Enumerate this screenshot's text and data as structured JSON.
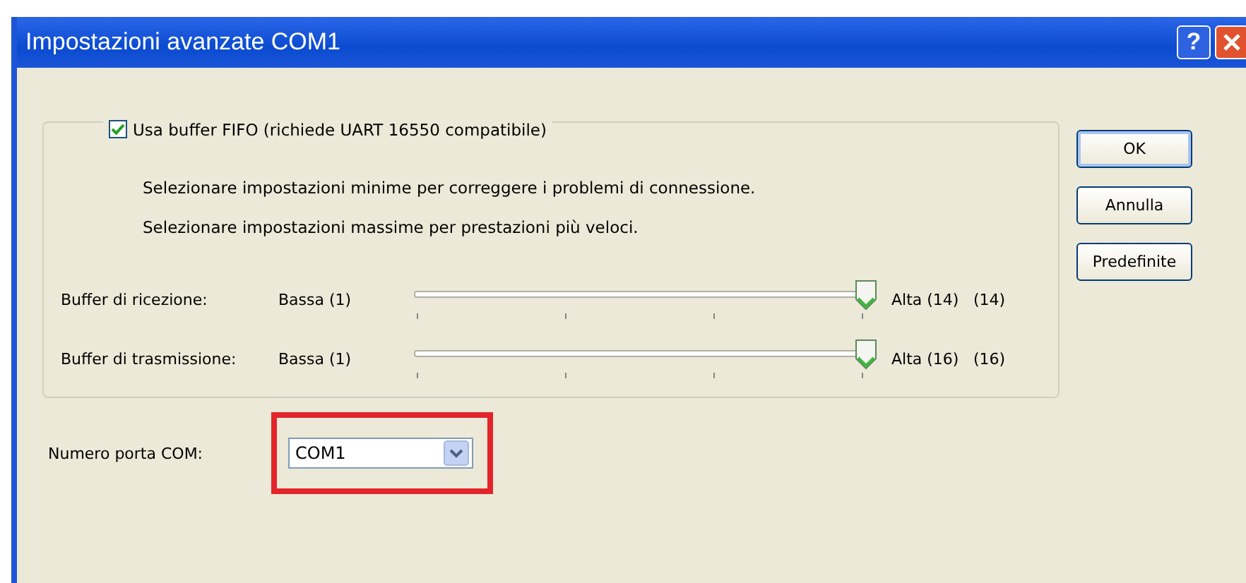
{
  "window": {
    "title": "Impostazioni avanzate COM1",
    "help_button": "?"
  },
  "fifo": {
    "label": "Usa buffer FIFO (richiede UART 16550 compatibile)",
    "checked": true
  },
  "hints": [
    "Selezionare impostazioni minime per correggere i problemi di connessione.",
    "Selezionare impostazioni massime per prestazioni più veloci."
  ],
  "sliders": [
    {
      "label": "Buffer di ricezione:",
      "min_label": "Bassa (1)",
      "max_label": "Alta (14)",
      "level": 1,
      "reading": "(14)"
    },
    {
      "label": "Buffer di trasmissione:",
      "min_label": "Bassa (1)",
      "max_label": "Alta (16)",
      "level": 1,
      "reading": "(16)"
    }
  ],
  "buttons": [
    "OK",
    "Annulla",
    "Predefinite"
  ],
  "com_port": {
    "label": "Numero porta COM:",
    "value": "COM1",
    "highlighted": true
  }
}
